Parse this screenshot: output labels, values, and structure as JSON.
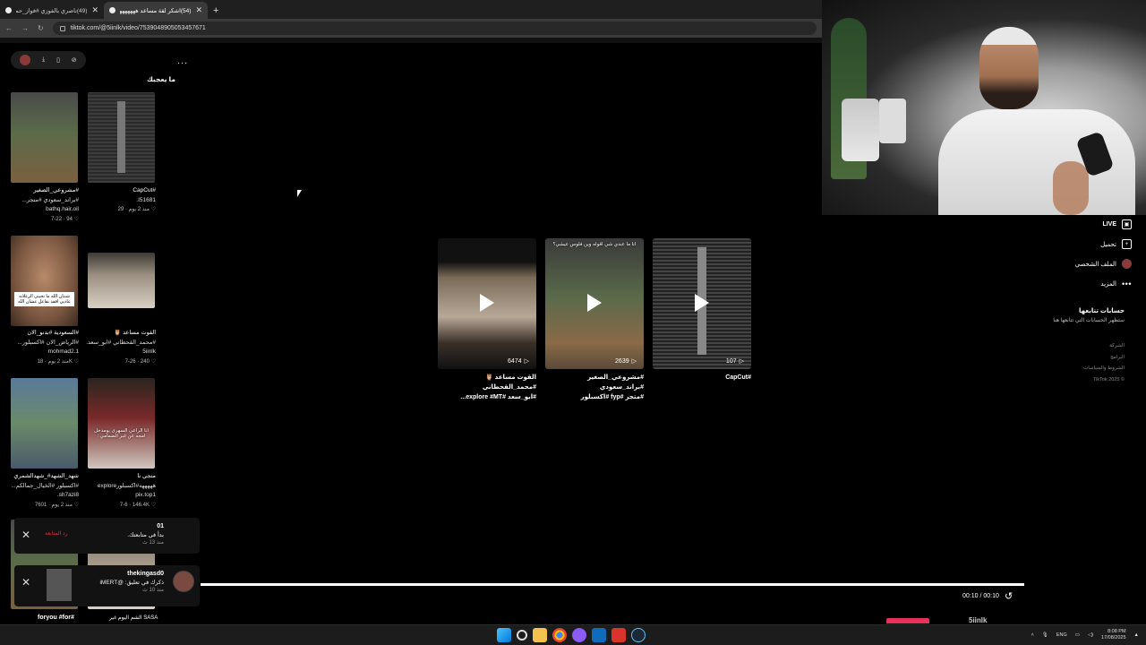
{
  "browser": {
    "tabs": [
      {
        "title": "(49)ناصري بالفوزي #فواز_حمد_ا..."
      },
      {
        "title": "(54)اشكر لقة مساعد هههههههههه..."
      }
    ],
    "new_tab": "+",
    "url": "tiktok.com/@5iinlk/video/7539048905053457671"
  },
  "left_panel": {
    "more": "...",
    "liked_title": "ما يعجبك",
    "cards": [
      {
        "l1": "#مشروعي_الصغير",
        "l2": "#براند_سعودي #متجر...",
        "l3": "bathq.hair.oil",
        "meta": "7-22 · 94 ♡"
      },
      {
        "l1": "#CapCut",
        "l2": "I51681.",
        "l3": "",
        "meta": "منذ 2 يوم · 29 ♡"
      },
      {
        "l1": "#السعودية #بدنو_الان",
        "l2": "#الرياض_الان #اكسبلور...",
        "l3": "mohmad2.1",
        "meta": "منذ 2 يوم · 18K ♡"
      },
      {
        "l1": "القوت مساعد 🦉",
        "l2": "#محمد_القحطاني #ابو_سعد...",
        "l3": "5iinlk",
        "meta": "7-26 · 240 ♡"
      },
      {
        "l1": "شهد_الشهد#_شهدالشمري",
        "l2": "#اكسبلور #الخيال_جمالكم...",
        "l3": "sh7azi8.",
        "meta": "منذ 2 يوم · 7601 ♡"
      },
      {
        "l1": "منجي نا",
        "l2": "هههههه#اكسبلورexplore",
        "l3": "pix.top1",
        "meta": "7-6 · 146.4K ♡"
      }
    ],
    "thumb_caption_face": "شنتان الله ما تجيني الزعلانه عاديي افقد تفاعل عشان الله",
    "thumb_caption_shemagh": "انا الراعي السهرى يومدخل امجه عن غبر الضمامي :"
  },
  "notifications": [
    {
      "name": "01",
      "message": "بدأ في متابعتك.",
      "time": "منذ 13 ث",
      "action": "رد المتابعة"
    },
    {
      "name": "thekingasd0",
      "message": "ذكرك في تعليق: @iMERT",
      "time": "منذ 10 ث"
    }
  ],
  "bottom_labels": {
    "left": "foryou #for#",
    "right": "الشم اليوم غير SASA"
  },
  "videos": [
    {
      "views": "6474",
      "title1": "القوت مساعد 🦉 #محمد_القحطاني",
      "title2": "#ابو_سعد #explore #MT..."
    },
    {
      "views": "2639",
      "title1": "#مشروعي_الصغير #براند_سعودي",
      "title2": "#متجر #fyp #اكسبلور",
      "overlay": "انا ما عندي شي اقوله وين فلوس عيشي؟"
    },
    {
      "views": "107",
      "title1": "#CapCut",
      "title2": ""
    }
  ],
  "right_menu": {
    "live": "LIVE",
    "upload": "تحميل",
    "profile": "الملف الشخصي",
    "more": "المزيد"
  },
  "following": {
    "title": "حسابات تتابعها",
    "subtitle": "ستظهر الحسابات التي تتابعها هنا"
  },
  "footer_links": [
    "الشركة",
    "البرامج",
    "الشروط والسياسات",
    "© TikTok 2025"
  ],
  "player": {
    "time": "00:10 / 00:10",
    "progress": 1.0,
    "bottom_name": "5iinlk"
  },
  "taskbar": {
    "lang": "ENG",
    "time": "8:08 PM",
    "date": "17/08/2025"
  },
  "colors": {
    "accent": "#e8305a",
    "notif_red": "#e8303a"
  }
}
